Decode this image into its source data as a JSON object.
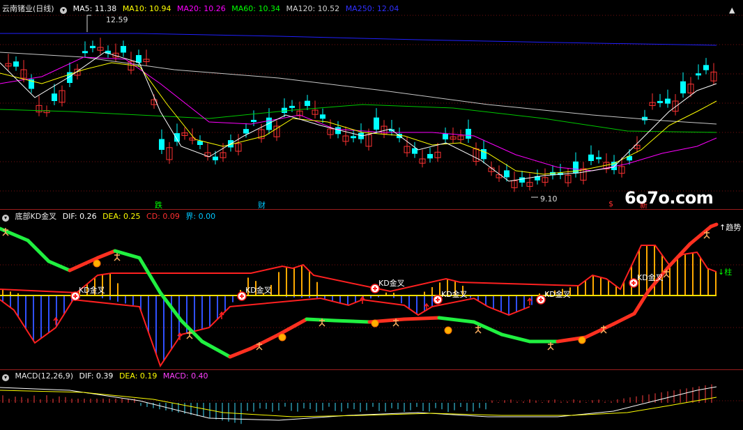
{
  "panel1": {
    "stock": "云南锗业(日线)",
    "ma": [
      {
        "label": "MA5: 11.38",
        "color": "#ffffff"
      },
      {
        "label": "MA10: 10.94",
        "color": "#ffff00"
      },
      {
        "label": "MA20: 10.26",
        "color": "#ff00ff"
      },
      {
        "label": "MA60: 10.34",
        "color": "#00ff00"
      },
      {
        "label": "MA120: 10.52",
        "color": "#d0d0d0"
      },
      {
        "label": "MA250: 12.04",
        "color": "#2020ff"
      }
    ],
    "high_label": "12.59",
    "low_label": "9.10",
    "markers": {
      "die": "跌",
      "cai": "财",
      "s": "$",
      "x": "新"
    },
    "watermark": "6o7o.com"
  },
  "panel2": {
    "title": "底部KD金叉",
    "values": [
      {
        "label": "DIF: 0.26",
        "color": "#ffffff"
      },
      {
        "label": "DEA: 0.25",
        "color": "#ffff00"
      },
      {
        "label": "CD: 0.09",
        "color": "#ff3030"
      },
      {
        "label": "界: 0.00",
        "color": "#00c8ff"
      }
    ],
    "kd_label": "KD金叉",
    "trend_label": "↑趋势",
    "pillar_label": "↓柱"
  },
  "panel3": {
    "title": "MACD(12,26,9)",
    "values": [
      {
        "label": "DIF: 0.39",
        "color": "#ffffff"
      },
      {
        "label": "DEA: 0.19",
        "color": "#ffff00"
      },
      {
        "label": "MACD: 0.40",
        "color": "#ff00ff"
      }
    ]
  },
  "colors": {
    "up": "#ff3232",
    "down": "#00ffff",
    "grid": "#7a1010"
  }
}
